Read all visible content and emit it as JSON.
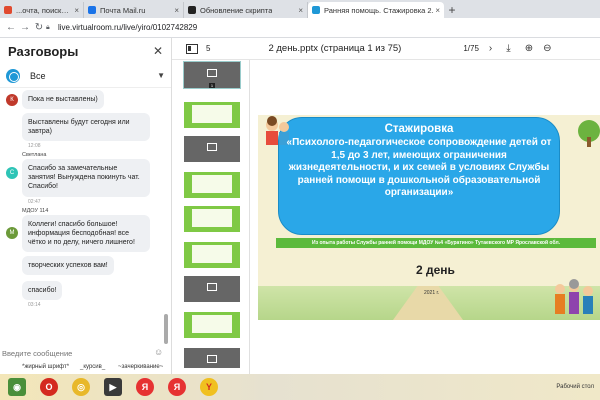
{
  "browser": {
    "tabs": [
      {
        "title": "...очта, поиск в интерне",
        "color": "#e04a2f",
        "active": false
      },
      {
        "title": "Почта Mail.ru",
        "color": "#1a73e8",
        "active": false
      },
      {
        "title": "Обновление скрипта",
        "color": "#222",
        "active": false
      },
      {
        "title": "Ранняя помощь. Стажировка 2.",
        "color": "#1f98d6",
        "active": true
      }
    ],
    "url": "live.virtualroom.ru/live/yiro/0102742829"
  },
  "chat": {
    "title": "Разговоры",
    "filter_label": "Все",
    "messages": [
      {
        "text": "Пока не выставлены)",
        "avatar": "К",
        "avatar_color": "#c0392b"
      },
      {
        "text": "Выставлены будут сегодня или завтра)",
        "time": "12:08"
      },
      {
        "sender": "Светлана",
        "avatar": "С",
        "avatar_color": "#2ec4b6",
        "text": "Спасибо за замечательные занятия! Вынуждена покинуть чат. Спасибо!",
        "time": "02:47"
      },
      {
        "sender": "МДОУ 114",
        "avatar": "М",
        "avatar_color": "#6c9a3a",
        "text": "Коллеги! спасибо большое! информация бесподобная! все чётко и по делу, ничего лишнего!"
      },
      {
        "text": "творческих успехов вам!"
      },
      {
        "text": "спасибо!",
        "time": "03:14"
      }
    ],
    "input_placeholder": "Введите сообщение",
    "format_bold": "*жирный шрифт*",
    "format_italic": "_курсив_",
    "format_strike": "~зачеркивание~"
  },
  "toolbar": {
    "thumbs_count": "5",
    "doc_title": "2 день.pptx (страница 1 из 75)",
    "page_nav": "1/75"
  },
  "thumbnails": {
    "first_number": "1"
  },
  "slide": {
    "heading": "Стажировка",
    "subtitle": "«Психолого-педагогическое сопровождение детей от 1,5 до 3 лет, имеющих ограничения жизнедеятельности, и их семей в условиях Службы ранней помощи в дошкольной образовательной организации»",
    "source_line": "Из опыта работы Службы ранней помощи МДОУ №4 «Буратино» Тутаевского МР Ярославской обл.",
    "day": "2 день",
    "year": "2021 г."
  },
  "taskbar": {
    "clock": "Рабочий стол"
  }
}
